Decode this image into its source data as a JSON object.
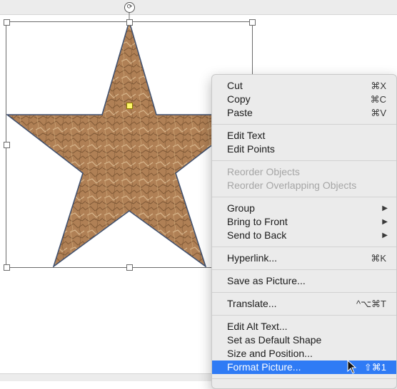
{
  "menu": {
    "cut": {
      "label": "Cut",
      "shortcut": "⌘X"
    },
    "copy": {
      "label": "Copy",
      "shortcut": "⌘C"
    },
    "paste": {
      "label": "Paste",
      "shortcut": "⌘V"
    },
    "edit_text": {
      "label": "Edit Text"
    },
    "edit_points": {
      "label": "Edit Points"
    },
    "reorder_objects": {
      "label": "Reorder Objects"
    },
    "reorder_overlapping": {
      "label": "Reorder Overlapping Objects"
    },
    "group": {
      "label": "Group"
    },
    "bring_to_front": {
      "label": "Bring to Front"
    },
    "send_to_back": {
      "label": "Send to Back"
    },
    "hyperlink": {
      "label": "Hyperlink...",
      "shortcut": "⌘K"
    },
    "save_as_picture": {
      "label": "Save as Picture..."
    },
    "translate": {
      "label": "Translate...",
      "shortcut": "^⌥⌘T"
    },
    "edit_alt_text": {
      "label": "Edit Alt Text..."
    },
    "set_default_shape": {
      "label": "Set as Default Shape"
    },
    "size_and_position": {
      "label": "Size and Position..."
    },
    "format_picture": {
      "label": "Format Picture...",
      "shortcut": "⇧⌘1"
    }
  },
  "colors": {
    "highlight": "#2f7bf5",
    "star_fill": "#b08055",
    "star_outline": "#3e4f6e"
  },
  "icons": {
    "rotate": "rotate-icon",
    "submenu": "submenu-arrow-icon",
    "cursor": "pointer-cursor-icon"
  }
}
